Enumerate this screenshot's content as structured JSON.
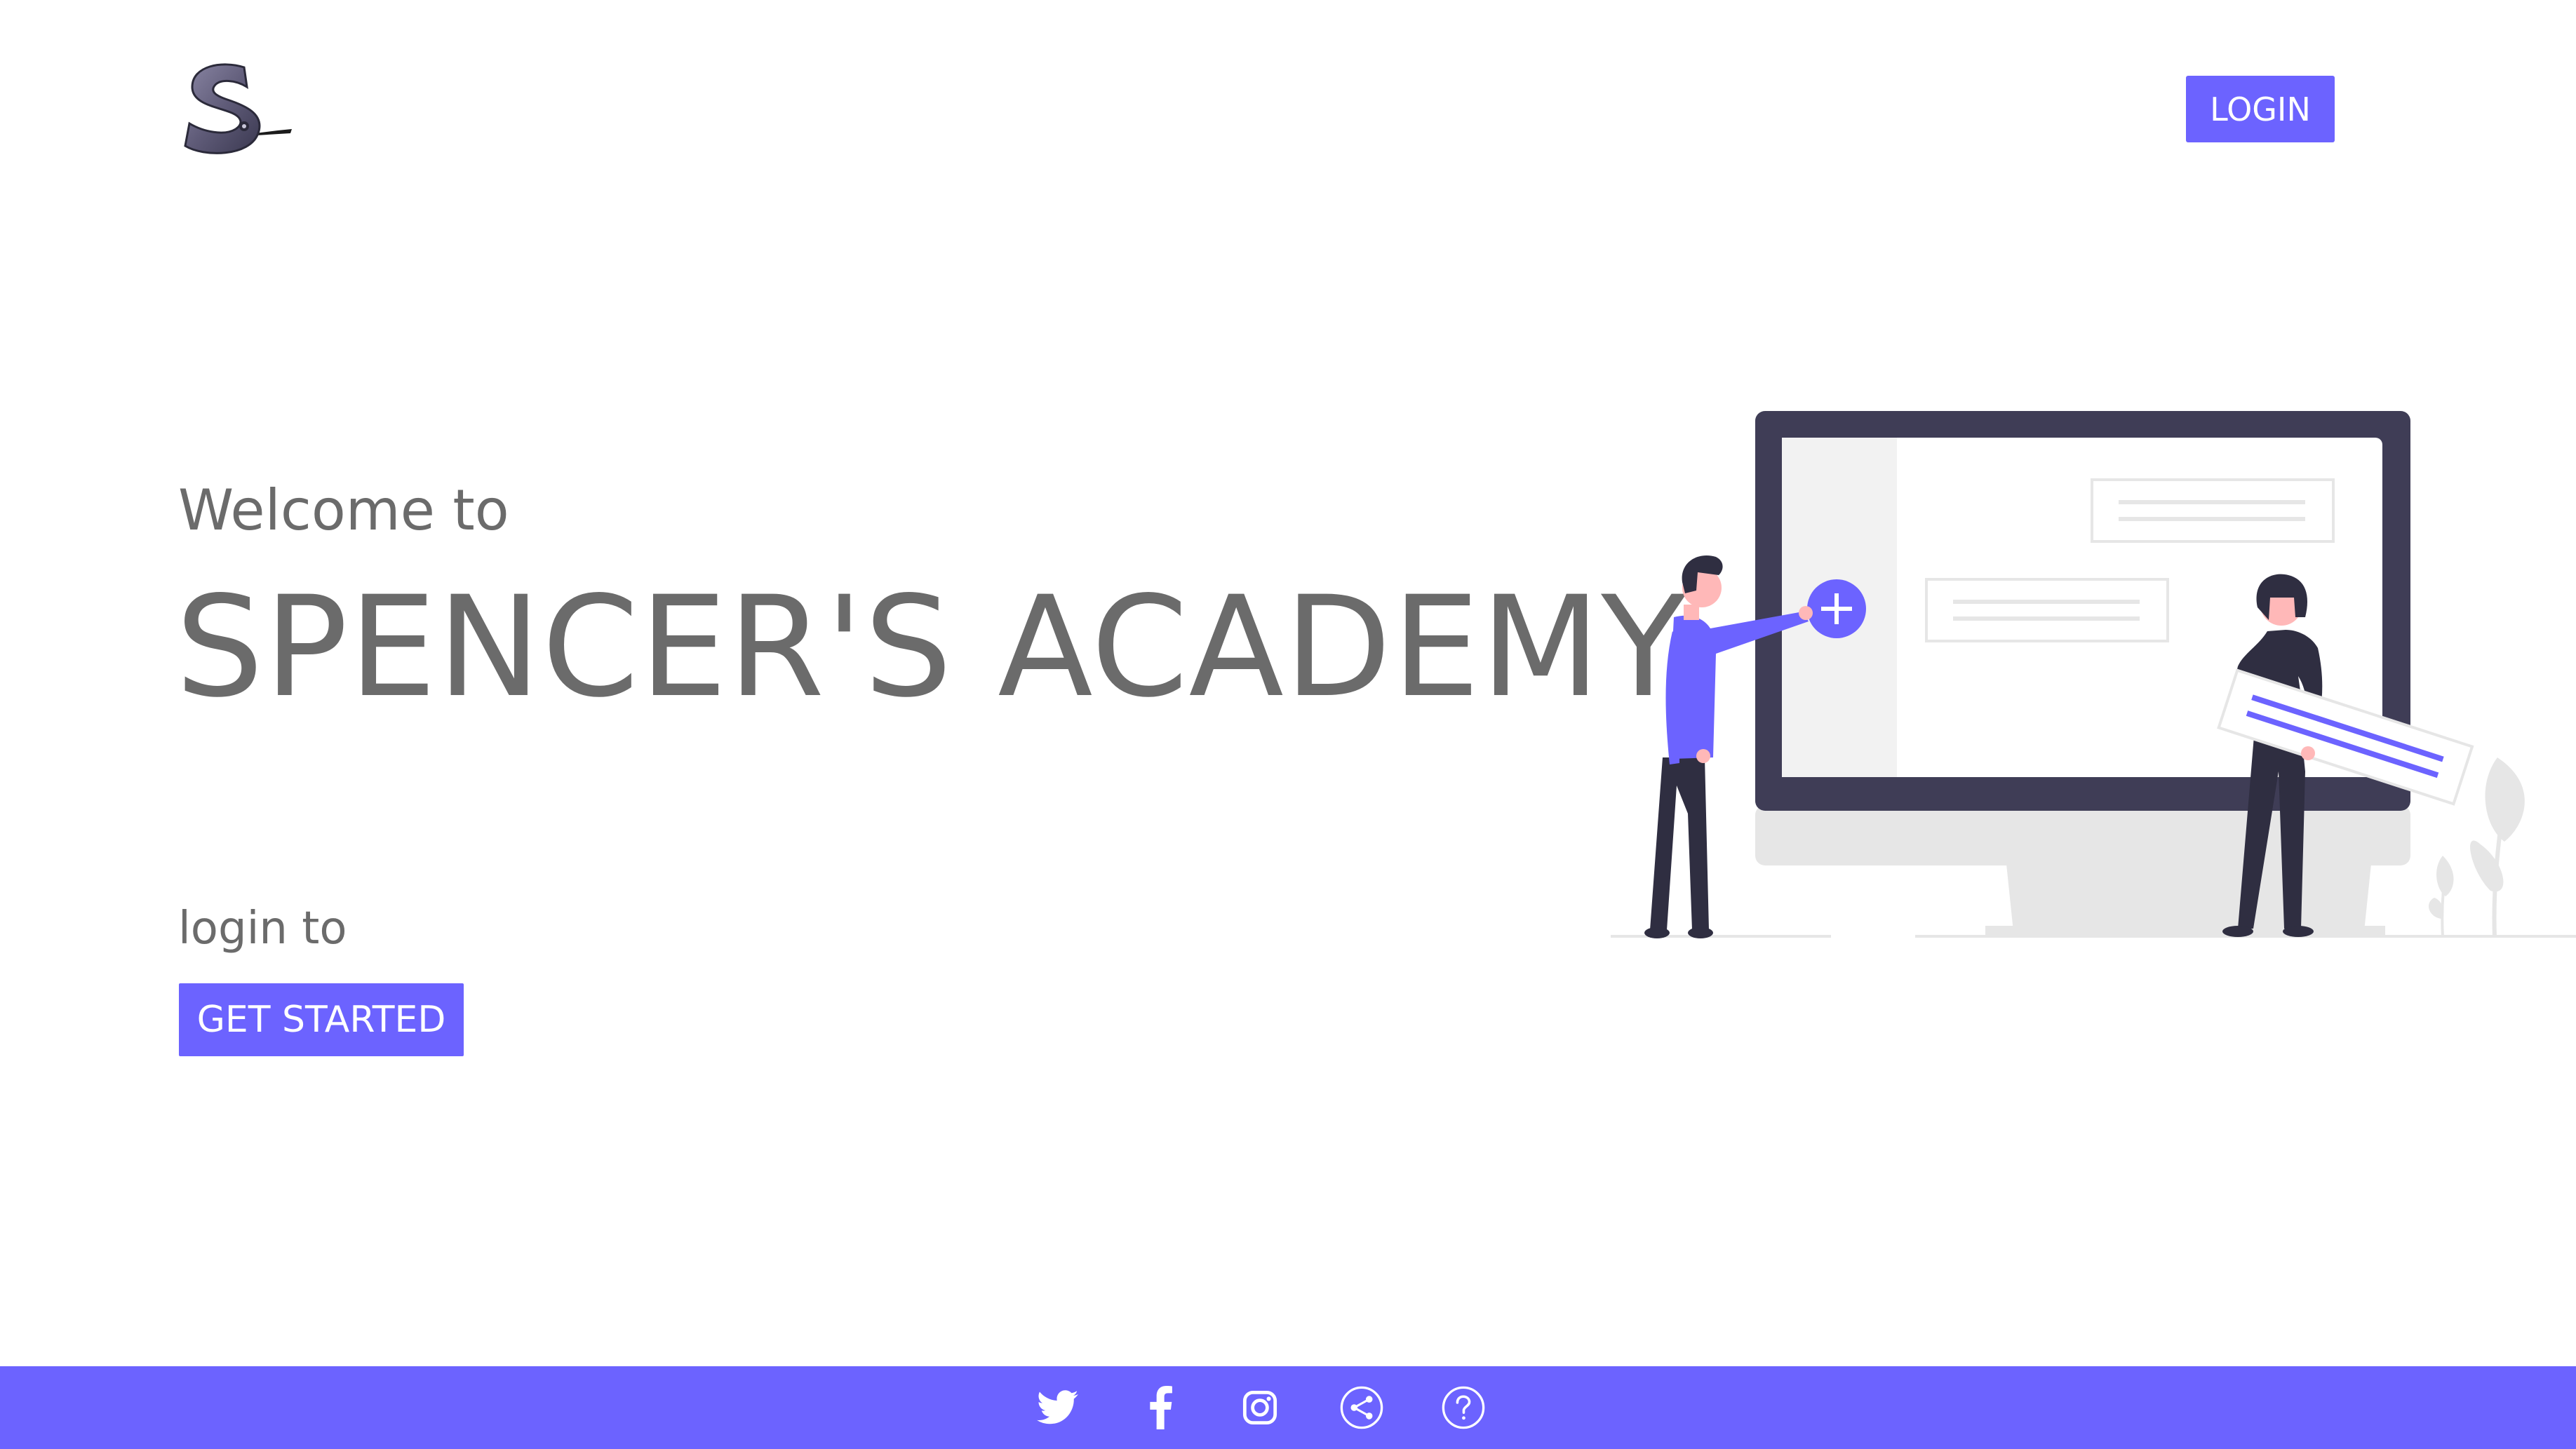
{
  "header": {
    "logo": {
      "letter": "S",
      "icon": "brand-s-logo"
    },
    "login_label": "LOGIN"
  },
  "hero": {
    "welcome_text": "Welcome to",
    "title": "SPENCER'S ACADEMY",
    "login_prompt": "login to",
    "cta_label": "GET STARTED"
  },
  "illustration": {
    "icon": "monitor-with-people-illustration"
  },
  "footer": {
    "icons": [
      "twitter-icon",
      "facebook-icon",
      "instagram-icon",
      "share-icon",
      "help-icon"
    ]
  },
  "colors": {
    "accent": "#6c63ff",
    "text": "#6b6b6b",
    "monitor_frame": "#3f3d56",
    "monitor_stand": "#e6e6e6",
    "background": "#ffffff"
  }
}
